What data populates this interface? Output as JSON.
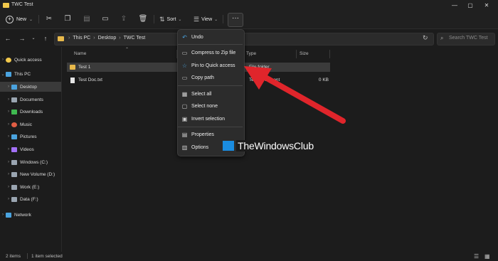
{
  "window": {
    "title": "TWC Test",
    "controls": [
      "—",
      "▢",
      "✕"
    ]
  },
  "toolbar": {
    "new_label": "New",
    "sort_label": "Sort",
    "view_label": "View",
    "more_label": "···"
  },
  "address": {
    "crumbs": [
      "This PC",
      "Desktop",
      "TWC Test"
    ],
    "search_placeholder": "Search TWC Test"
  },
  "sidebar": {
    "items": [
      {
        "label": "Quick access",
        "icon": "star-icon",
        "color": "#f2c94c"
      },
      {
        "label": "This PC",
        "icon": "pc-icon",
        "color": "#4aa3df"
      },
      {
        "label": "Desktop",
        "icon": "desktop-icon",
        "color": "#4aa3df"
      },
      {
        "label": "Documents",
        "icon": "documents-icon",
        "color": "#9aa5b1"
      },
      {
        "label": "Downloads",
        "icon": "downloads-icon",
        "color": "#3fb950"
      },
      {
        "label": "Music",
        "icon": "music-icon",
        "color": "#e05d44"
      },
      {
        "label": "Pictures",
        "icon": "pictures-icon",
        "color": "#4aa3df"
      },
      {
        "label": "Videos",
        "icon": "videos-icon",
        "color": "#a371f7"
      },
      {
        "label": "Windows (C:)",
        "icon": "drive-icon",
        "color": "#9aa5b1"
      },
      {
        "label": "New Volume (D:)",
        "icon": "drive-icon",
        "color": "#9aa5b1"
      },
      {
        "label": "Work (E:)",
        "icon": "drive-icon",
        "color": "#9aa5b1"
      },
      {
        "label": "Data (F:)",
        "icon": "drive-icon",
        "color": "#9aa5b1"
      },
      {
        "label": "Network",
        "icon": "network-icon",
        "color": "#4aa3df"
      }
    ]
  },
  "columns": {
    "name": "Name",
    "type": "Type",
    "size": "Size"
  },
  "files": [
    {
      "name": "Test 1",
      "type": "File folder",
      "size": ""
    },
    {
      "name": "Test Doc.txt",
      "type": "Text Document",
      "size": "0 KB"
    }
  ],
  "context_menu": {
    "items": [
      {
        "label": "Undo",
        "icon": "undo-icon"
      },
      {
        "label": "Compress to Zip file",
        "icon": "zip-icon"
      },
      {
        "label": "Pin to Quick access",
        "icon": "pin-icon"
      },
      {
        "label": "Copy path",
        "icon": "copy-path-icon"
      },
      {
        "label": "Select all",
        "icon": "select-all-icon"
      },
      {
        "label": "Select none",
        "icon": "select-none-icon"
      },
      {
        "label": "Invert selection",
        "icon": "invert-selection-icon"
      },
      {
        "label": "Properties",
        "icon": "properties-icon"
      },
      {
        "label": "Options",
        "icon": "options-icon"
      }
    ]
  },
  "status": {
    "item_count": "2 items",
    "selected": "1 item selected"
  },
  "watermark": {
    "text": "TheWindowsClub"
  },
  "colors": {
    "arrow": "#e0252b",
    "folder": "#e8b94b",
    "accent": "#4aa3df"
  }
}
